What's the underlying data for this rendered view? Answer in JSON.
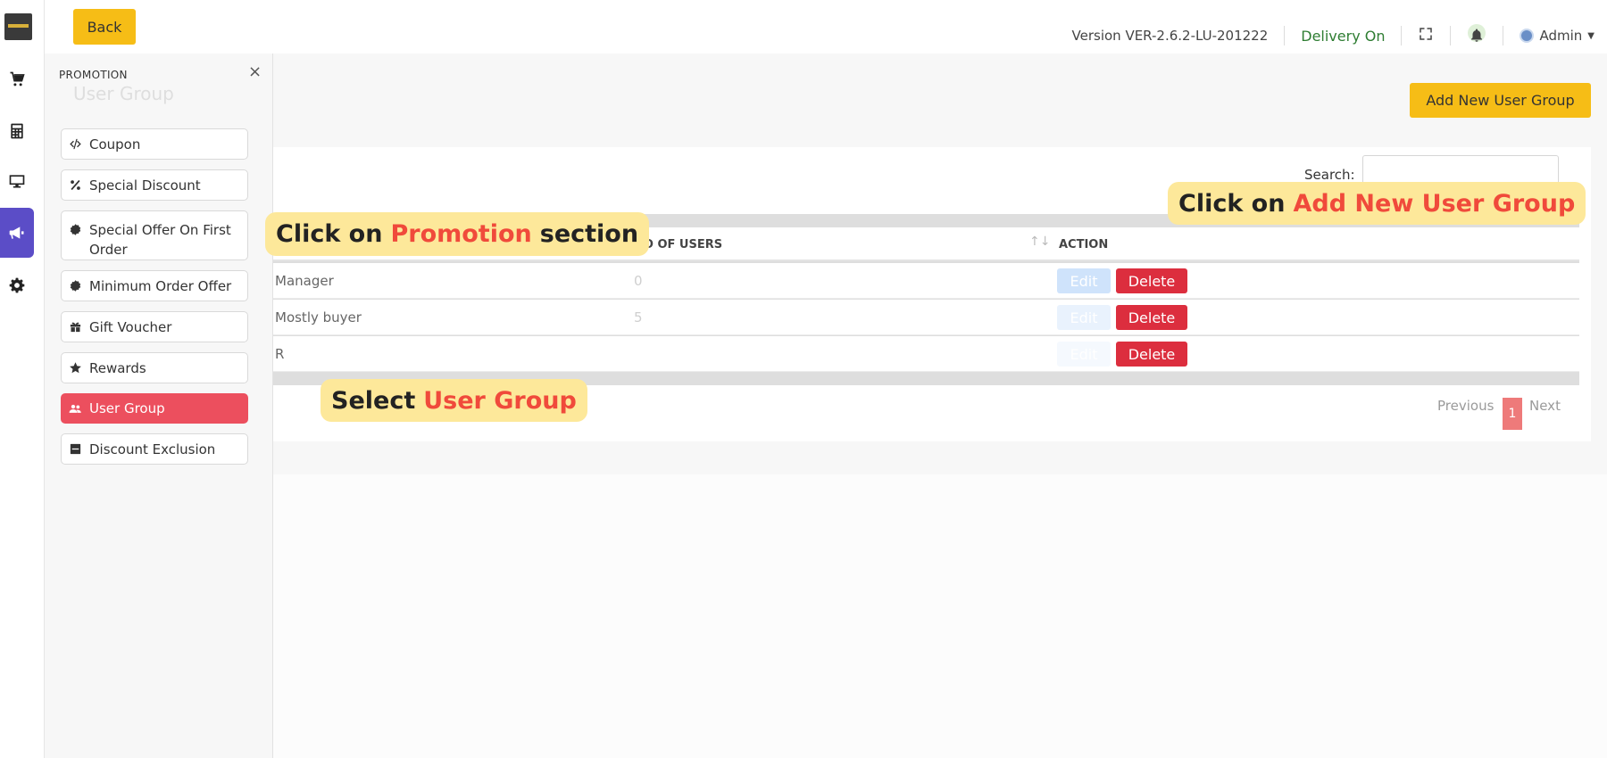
{
  "topbar": {
    "back_label": "Back",
    "version": "Version VER-2.6.2-LU-201222",
    "delivery_status": "Delivery On",
    "user_name": "Admin"
  },
  "rail": {
    "items": [
      {
        "icon": "cart-icon"
      },
      {
        "icon": "calculator-icon"
      },
      {
        "icon": "monitor-icon"
      },
      {
        "icon": "megaphone-icon",
        "active": true
      },
      {
        "icon": "gear-icon"
      }
    ]
  },
  "promotion_panel": {
    "title": "PROMOTION",
    "close": "×",
    "ghost_page_title": "User Group",
    "items": [
      {
        "label": "Coupon",
        "icon": "code-icon"
      },
      {
        "label": "Special Discount",
        "icon": "percent-icon"
      },
      {
        "label": "Special Offer On First Order",
        "icon": "badge-icon"
      },
      {
        "label": "Minimum Order Offer",
        "icon": "badge-icon"
      },
      {
        "label": "Gift Voucher",
        "icon": "gift-icon"
      },
      {
        "label": "Rewards",
        "icon": "star-icon"
      },
      {
        "label": "User Group",
        "icon": "users-icon",
        "active": true
      },
      {
        "label": "Discount Exclusion",
        "icon": "minus-square-icon"
      }
    ]
  },
  "main": {
    "add_button_label": "Add New User Group",
    "search_label": "Search:",
    "table": {
      "headers": [
        "NO OF USERS",
        "ACTION"
      ],
      "rows": [
        {
          "name": "Manager",
          "users": "0",
          "edit": "Edit",
          "delete": "Delete"
        },
        {
          "name": "Mostly buyer",
          "users": "5",
          "edit": "Edit",
          "delete": "Delete"
        },
        {
          "name": "R",
          "users": "",
          "edit": "Edit",
          "delete": "Delete"
        }
      ]
    },
    "pagination": {
      "previous": "Previous",
      "current": "1",
      "next": "Next"
    }
  },
  "callouts": {
    "promotion": {
      "before": "Click on",
      "highlight": "Promotion",
      "after": "section"
    },
    "user_group": {
      "before": "Select",
      "highlight": "User Group"
    },
    "add_group": {
      "before": "Click on",
      "highlight": "Add New User Group"
    }
  },
  "colors": {
    "accent_yellow": "#f6bd16",
    "active_purple": "#5b4dc7",
    "delete_red": "#dc2e3e",
    "active_item_red": "#ec4f5e",
    "delivery_green": "#2e7d32",
    "callout_bg": "#fde89a",
    "callout_highlight": "#f04a3b"
  }
}
